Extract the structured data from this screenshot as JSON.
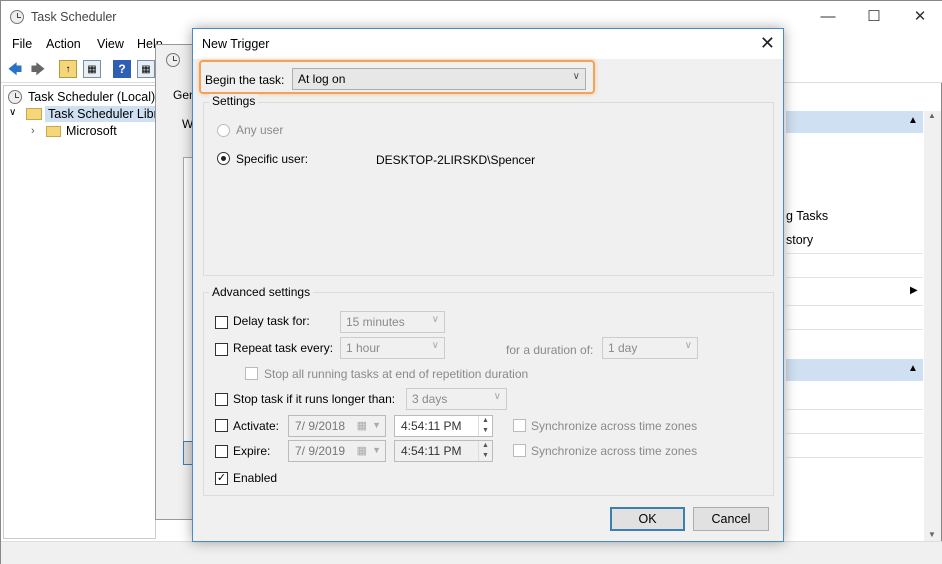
{
  "app": {
    "title": "Task Scheduler"
  },
  "menu": [
    "File",
    "Action",
    "View",
    "Help"
  ],
  "tree": {
    "items": [
      "Task Scheduler (Local)",
      "Task Scheduler Library",
      "Microsoft"
    ]
  },
  "back_dialog": {
    "tab_fragment": "Gen",
    "line_fragment": "W"
  },
  "right_pane": {
    "lines": [
      "g Tasks",
      "story"
    ]
  },
  "dialog": {
    "title": "New Trigger",
    "begin_label": "Begin the task:",
    "begin_value": "At log on",
    "settings_label": "Settings",
    "any_user": "Any user",
    "specific_user": "Specific user:",
    "user_name": "DESKTOP-2LIRSKD\\Spencer",
    "advanced_label": "Advanced settings",
    "delay_label": "Delay task for:",
    "delay_value": "15 minutes",
    "repeat_label": "Repeat task every:",
    "repeat_value": "1 hour",
    "duration_label": "for a duration of:",
    "duration_value": "1 day",
    "stop_all_label": "Stop all running tasks at end of repetition duration",
    "stop_longer_label": "Stop task if it runs longer than:",
    "stop_longer_value": "3 days",
    "activate_label": "Activate:",
    "activate_date": "7/ 9/2018",
    "activate_time": "4:54:11 PM",
    "expire_label": "Expire:",
    "expire_date": "7/ 9/2019",
    "expire_time": "4:54:11 PM",
    "sync_label": "Synchronize across time zones",
    "enabled_label": "Enabled",
    "ok": "OK",
    "cancel": "Cancel"
  },
  "colors": {
    "accent": "#3c7fb1",
    "highlight": "#f4a15a",
    "selection": "#cfe0f2"
  }
}
